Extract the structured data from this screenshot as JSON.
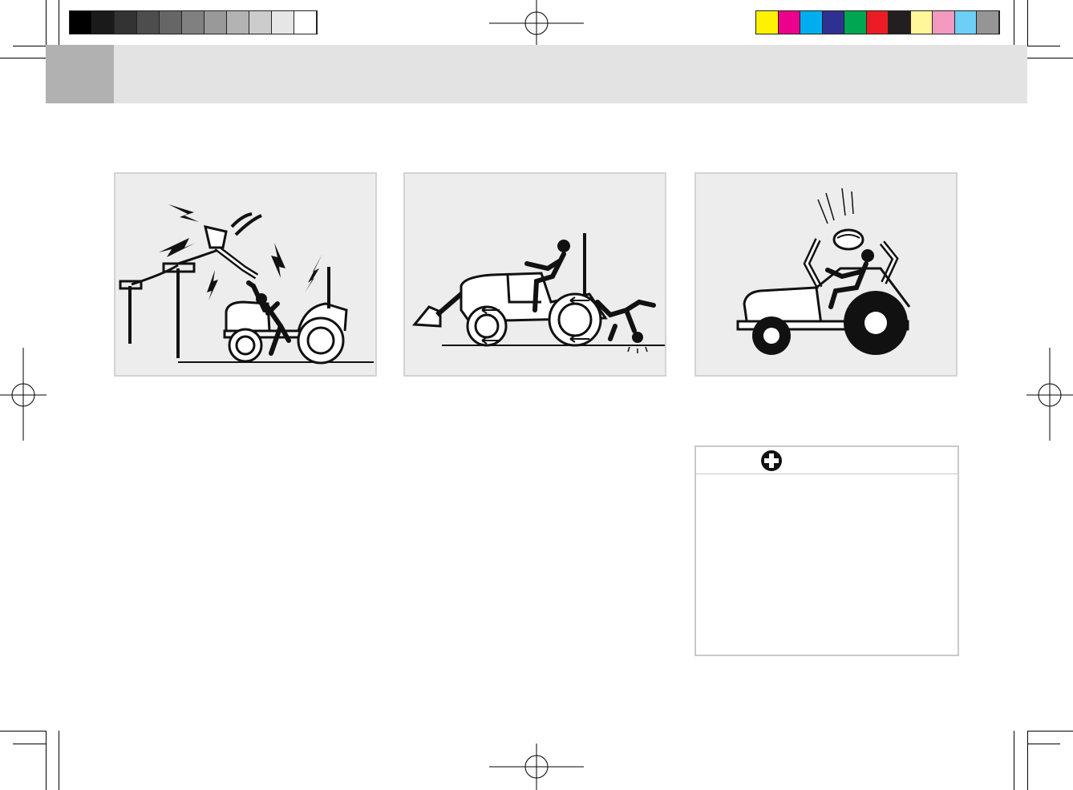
{
  "print_marks": {
    "grayscale_strip": [
      "#000000",
      "#1a1a1a",
      "#333333",
      "#4d4d4d",
      "#666666",
      "#808080",
      "#999999",
      "#b3b3b3",
      "#cccccc",
      "#e6e6e6",
      "#ffffff"
    ],
    "color_strip": [
      "#fff200",
      "#ec008c",
      "#00aeef",
      "#2e3192",
      "#00a651",
      "#ed1c24",
      "#231f20",
      "#fff799",
      "#f49ac1",
      "#6dcff6",
      "#959595"
    ]
  },
  "header": {
    "tab_color": "#b1b1b1",
    "bar_color": "#e3e3e3"
  },
  "illustrations": [
    {
      "id": "power-line-hazard",
      "icon": "electrocution-illustration"
    },
    {
      "id": "runover-hazard",
      "icon": "tractor-runover-illustration"
    },
    {
      "id": "falling-object-hazard",
      "icon": "falling-object-illustration"
    }
  ],
  "first_aid_box": {
    "icon": "first-aid-cross-icon",
    "border_color": "#c9c9c9"
  }
}
